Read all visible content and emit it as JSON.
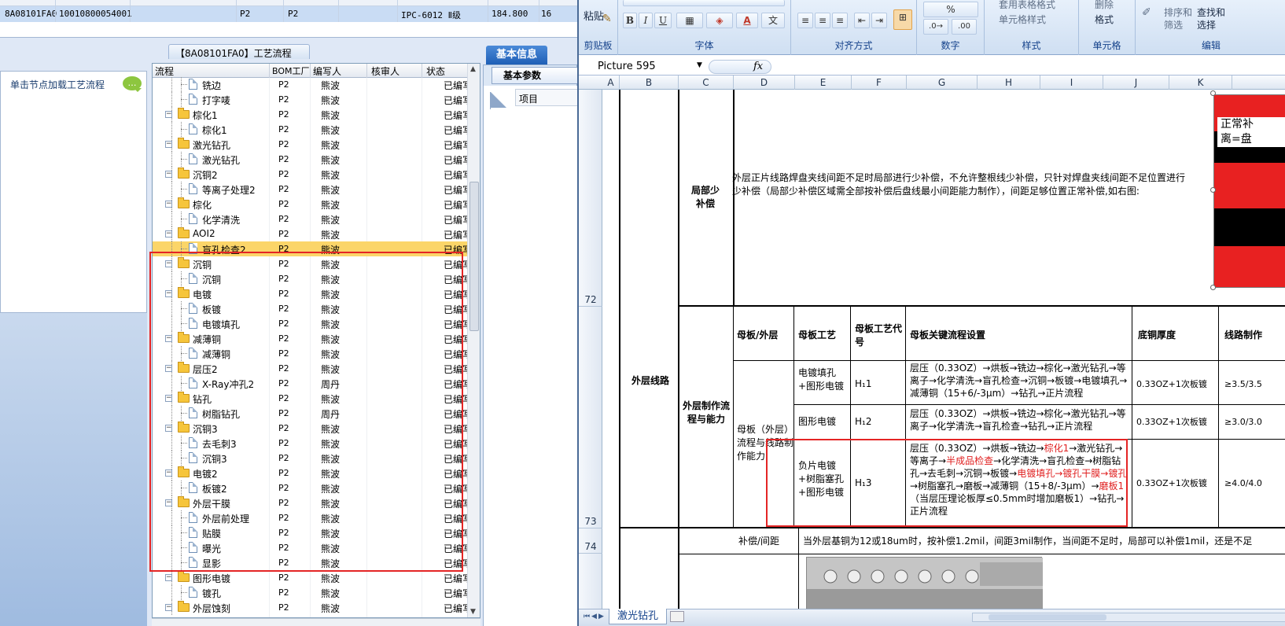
{
  "top_grid": {
    "row": {
      "lot": "8A08101FA0",
      "code": "10010800054001",
      "f1": "P2",
      "f2": "P2",
      "grade": "IPC-6012 Ⅱ级",
      "value": "184.800",
      "trunc": "16"
    }
  },
  "left_panel": {
    "title": "【8A08101FA0】工艺流程",
    "sidebar_hint": "单击节点加载工艺流程",
    "bubble_icon": "speech-bubble-icon"
  },
  "tree": {
    "headers": {
      "flow": "流程",
      "bom": "BOM工厂",
      "editor": "编写人",
      "reviewer": "核审人",
      "status": "状态"
    },
    "rows": [
      {
        "type": "doc",
        "level": 2,
        "name": "铣边",
        "bom": "P2",
        "editor": "熊波",
        "status": "已编写"
      },
      {
        "type": "doc",
        "level": 2,
        "name": "打字唛",
        "bom": "P2",
        "editor": "熊波",
        "status": "已编写"
      },
      {
        "type": "folder",
        "level": 1,
        "name": "棕化1",
        "bom": "P2",
        "editor": "熊波",
        "status": "已编写"
      },
      {
        "type": "doc",
        "level": 2,
        "name": "棕化1",
        "bom": "P2",
        "editor": "熊波",
        "status": "已编写"
      },
      {
        "type": "folder",
        "level": 1,
        "name": "激光钻孔",
        "bom": "P2",
        "editor": "熊波",
        "status": "已编写"
      },
      {
        "type": "doc",
        "level": 2,
        "name": "激光钻孔",
        "bom": "P2",
        "editor": "熊波",
        "status": "已编写"
      },
      {
        "type": "folder",
        "level": 1,
        "name": "沉铜2",
        "bom": "P2",
        "editor": "熊波",
        "status": "已编写"
      },
      {
        "type": "doc",
        "level": 2,
        "name": "等离子处理2",
        "bom": "P2",
        "editor": "熊波",
        "status": "已编写"
      },
      {
        "type": "folder",
        "level": 1,
        "name": "棕化",
        "bom": "P2",
        "editor": "熊波",
        "status": "已编写"
      },
      {
        "type": "doc",
        "level": 2,
        "name": "化学清洗",
        "bom": "P2",
        "editor": "熊波",
        "status": "已编写"
      },
      {
        "type": "folder",
        "level": 1,
        "name": "AOI2",
        "bom": "P2",
        "editor": "熊波",
        "status": "已编写"
      },
      {
        "type": "doc",
        "level": 2,
        "name": "盲孔检查2",
        "bom": "P2",
        "editor": "熊波",
        "status": "已编写",
        "selected": true
      },
      {
        "type": "folder",
        "level": 1,
        "name": "沉铜",
        "bom": "P2",
        "editor": "熊波",
        "status": "已编写"
      },
      {
        "type": "doc",
        "level": 2,
        "name": "沉铜",
        "bom": "P2",
        "editor": "熊波",
        "status": "已编写"
      },
      {
        "type": "folder",
        "level": 1,
        "name": "电镀",
        "bom": "P2",
        "editor": "熊波",
        "status": "已编写"
      },
      {
        "type": "doc",
        "level": 2,
        "name": "板镀",
        "bom": "P2",
        "editor": "熊波",
        "status": "已编写"
      },
      {
        "type": "doc",
        "level": 2,
        "name": "电镀填孔",
        "bom": "P2",
        "editor": "熊波",
        "status": "已编写"
      },
      {
        "type": "folder",
        "level": 1,
        "name": "减薄铜",
        "bom": "P2",
        "editor": "熊波",
        "status": "已编写"
      },
      {
        "type": "doc",
        "level": 2,
        "name": "减薄铜",
        "bom": "P2",
        "editor": "熊波",
        "status": "已编写"
      },
      {
        "type": "folder",
        "level": 1,
        "name": "层压2",
        "bom": "P2",
        "editor": "熊波",
        "status": "已编写"
      },
      {
        "type": "doc",
        "level": 2,
        "name": "X-Ray冲孔2",
        "bom": "P2",
        "editor": "周丹",
        "status": "已编写"
      },
      {
        "type": "folder",
        "level": 1,
        "name": "钻孔",
        "bom": "P2",
        "editor": "熊波",
        "status": "已编写"
      },
      {
        "type": "doc",
        "level": 2,
        "name": "树脂钻孔",
        "bom": "P2",
        "editor": "周丹",
        "status": "已编写"
      },
      {
        "type": "folder",
        "level": 1,
        "name": "沉铜3",
        "bom": "P2",
        "editor": "熊波",
        "status": "已编写"
      },
      {
        "type": "doc",
        "level": 2,
        "name": "去毛刺3",
        "bom": "P2",
        "editor": "熊波",
        "status": "已编写"
      },
      {
        "type": "doc",
        "level": 2,
        "name": "沉铜3",
        "bom": "P2",
        "editor": "熊波",
        "status": "已编写"
      },
      {
        "type": "folder",
        "level": 1,
        "name": "电镀2",
        "bom": "P2",
        "editor": "熊波",
        "status": "已编写"
      },
      {
        "type": "doc",
        "level": 2,
        "name": "板镀2",
        "bom": "P2",
        "editor": "熊波",
        "status": "已编写"
      },
      {
        "type": "folder",
        "level": 1,
        "name": "外层干膜",
        "bom": "P2",
        "editor": "熊波",
        "status": "已编写"
      },
      {
        "type": "doc",
        "level": 2,
        "name": "外层前处理",
        "bom": "P2",
        "editor": "熊波",
        "status": "已编写"
      },
      {
        "type": "doc",
        "level": 2,
        "name": "贴膜",
        "bom": "P2",
        "editor": "熊波",
        "status": "已编写"
      },
      {
        "type": "doc",
        "level": 2,
        "name": "曝光",
        "bom": "P2",
        "editor": "熊波",
        "status": "已编写"
      },
      {
        "type": "doc",
        "level": 2,
        "name": "显影",
        "bom": "P2",
        "editor": "熊波",
        "status": "已编写"
      },
      {
        "type": "folder",
        "level": 1,
        "name": "图形电镀",
        "bom": "P2",
        "editor": "熊波",
        "status": "已编写"
      },
      {
        "type": "doc",
        "level": 2,
        "name": "镀孔",
        "bom": "P2",
        "editor": "熊波",
        "status": "已编写"
      },
      {
        "type": "folder",
        "level": 1,
        "name": "外层蚀刻",
        "bom": "P2",
        "editor": "熊波",
        "status": "已编写"
      }
    ]
  },
  "basic_info": {
    "tab": "基本信息",
    "sub_tab": "基本参数",
    "item_header": "项目"
  },
  "excel": {
    "ribbon": {
      "paste": "粘贴",
      "clipboard": "剪贴板",
      "font": "字体",
      "alignment": "对齐方式",
      "number": "数字",
      "styles": "样式",
      "cells": "单元格",
      "editing": "编辑",
      "table_style": "套用表格格式",
      "cell_style": "单元格样式",
      "delete": "删除",
      "format": "格式",
      "sort_filter": "排序和筛选",
      "find_select": "查找和选择",
      "percent": "%",
      "bold": "B",
      "italic": "I",
      "underline": "U",
      "font_color": "A",
      "wen": "文"
    },
    "name_box": "Picture 595",
    "fx": "fx",
    "columns": [
      "A",
      "B",
      "C",
      "D",
      "E",
      "F",
      "G",
      "H",
      "I",
      "J",
      "K"
    ],
    "rows": [
      "72",
      "73",
      "74"
    ],
    "cells": {
      "local_comp": "局部少补偿",
      "local_comp_text": "外层正片线路焊盘夹线间距不足时局部进行少补偿，不允许整根线少补偿，只针对焊盘夹线间距不足位置进行少补偿（局部少补偿区域需全部按补偿后盘线最小间距能力制作），间距足够位置正常补偿,如右图:",
      "outer_line": "外层线路",
      "flow_capability": "外层制作流程与能力",
      "mother_outer": "母板/外层",
      "mother_process": "母板工艺",
      "mother_code": "母板工艺代号",
      "key_flow": "母板关键流程设置",
      "base_copper": "底铜厚度",
      "line_make": "线路制作",
      "mother_side": "母板（外层）流程与线路制作能力",
      "r1_process": "电镀填孔+图形电镀",
      "r1_code": "H₁1",
      "r1_flow": "层压（0.33OZ）→烘板→铣边→棕化→激光钻孔→等离子→化学清洗→盲孔检查→沉铜→板镀→电镀填孔→减薄铜（15+6/-3μm）→钻孔→正片流程",
      "r1_copper": "0.33OZ+1次板镀",
      "r1_line": "≥3.5/3.5",
      "r2_process": "图形电镀",
      "r2_code": "H₁2",
      "r2_flow": "层压（0.33OZ）→烘板→铣边→棕化→激光钻孔→等离子→化学清洗→盲孔检查→钻孔→正片流程",
      "r2_copper": "0.33OZ+1次板镀",
      "r2_line": "≥3.0/3.0",
      "r3_process": "负片电镀+树脂塞孔+图形电镀",
      "r3_code": "H₁3",
      "r3_flow_a": "层压（0.33OZ）→烘板→铣边→",
      "r3_flow_red1": "棕化1",
      "r3_flow_b": "→激光钻孔→等离子→",
      "r3_flow_red2": "半成品检查",
      "r3_flow_c": "→化学清洗→盲孔检查→树脂钻孔→去毛刺→沉铜→板镀→",
      "r3_flow_red3": "电镀填孔→镀孔干膜→镀孔",
      "r3_flow_d": "→树脂塞孔→磨板→减薄铜（15+8/-3μm）→",
      "r3_flow_red4": "磨板1",
      "r3_flow_e": "（当层压理论板厚≤0.5mm时增加磨板1）→钻孔→正片流程",
      "r3_copper": "0.33OZ+1次板镀",
      "r3_line": "≥4.0/4.0",
      "comp_spacing": "补偿/间距",
      "comp_text": "当外层基铜为12或18um时，按补偿1.2mil，间距3mil制作，当间距不足时，局部可以补偿1mil，还是不足"
    },
    "picture_label_1": "正常补",
    "picture_label_2": "离=盘",
    "sheet_tab": "激光钻孔"
  },
  "colors": {
    "highlight_red": "#e42525",
    "selection_yellow": "#fbd569",
    "basic_tab_blue": "#2a6bc4"
  }
}
